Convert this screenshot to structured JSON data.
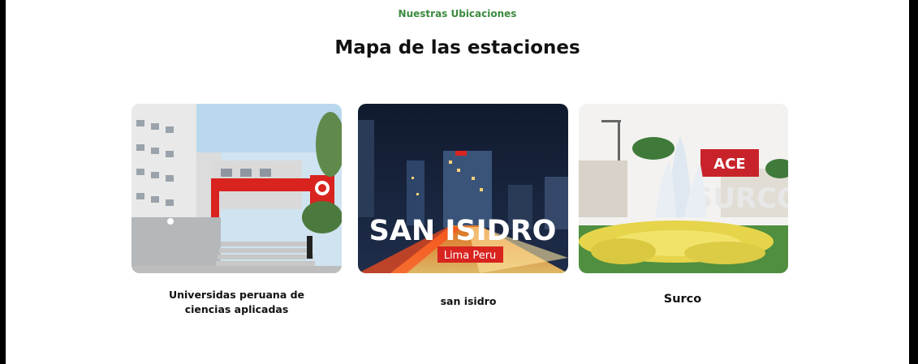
{
  "section": {
    "eyebrow": "Nuestras Ubicaciones",
    "title": "Mapa de las estaciones"
  },
  "locations": [
    {
      "caption": "Universidas peruana de ciencias aplicadas",
      "image": "upc-campus-photo"
    },
    {
      "caption": "san isidro",
      "image": "san-isidro-night-photo",
      "overlay_title": "SAN ISIDRO",
      "overlay_subtitle": "Lima  Peru"
    },
    {
      "caption": "Surco",
      "image": "surco-fountain-photo",
      "sign_text": "SURCO"
    }
  ],
  "colors": {
    "accent_green": "#3b8a3e",
    "text_dark": "#111111",
    "brand_red": "#d8231f"
  }
}
